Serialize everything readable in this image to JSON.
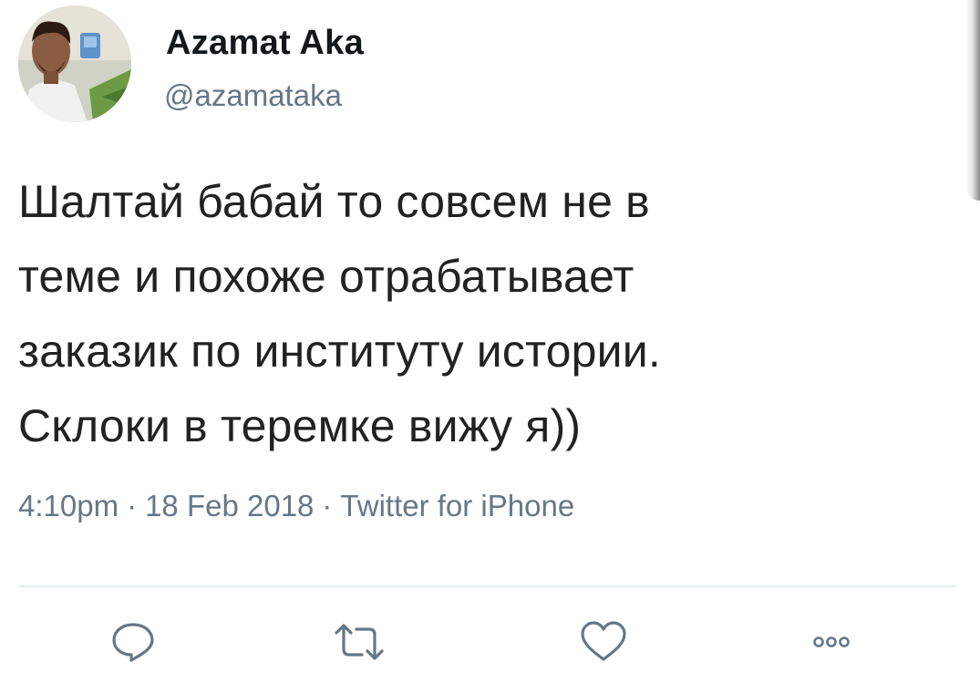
{
  "author": {
    "display_name": "Azamat Aka",
    "handle": "@azamataka"
  },
  "tweet": {
    "text_lines": [
      "Шалтай бабай то совсем не в",
      "теме и похоже отрабатывает",
      "заказик по институту истории.",
      "Склоки в теремке вижу я))"
    ]
  },
  "meta": {
    "time": "4:10pm",
    "separator": "·",
    "date": "18 Feb 2018",
    "source": "Twitter for iPhone"
  },
  "actions": {
    "reply_icon": "reply-icon",
    "retweet_icon": "retweet-icon",
    "like_icon": "heart-icon",
    "more_icon": "more-icon"
  },
  "colors": {
    "text": "#14171a",
    "secondary": "#657786",
    "divider": "#e6ecf0"
  }
}
